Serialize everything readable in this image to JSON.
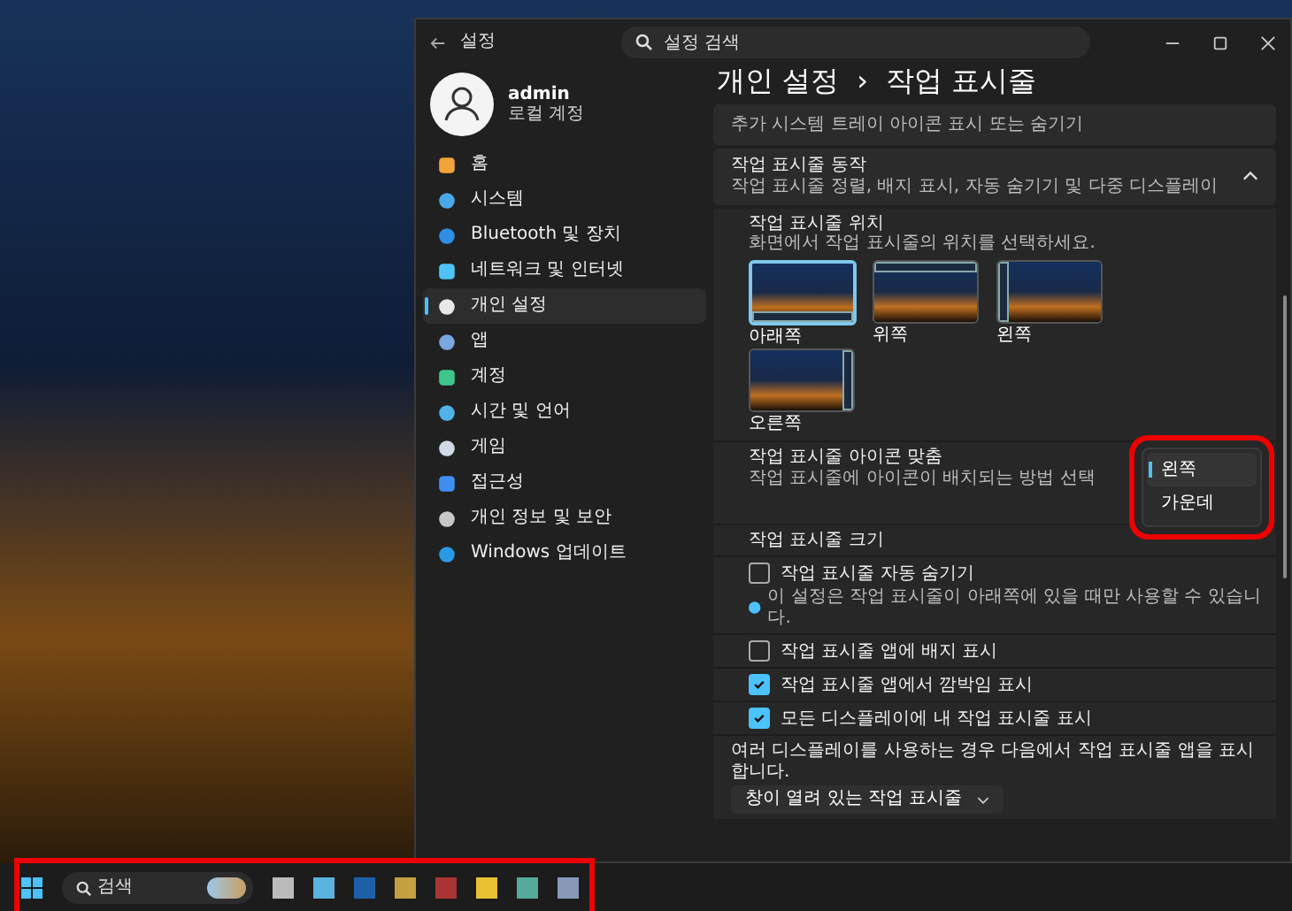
{
  "window": {
    "title": "설정",
    "search": {
      "placeholder": "설정 검색"
    }
  },
  "profile": {
    "name": "admin",
    "account": "로컬 계정"
  },
  "sidebar": {
    "items": [
      {
        "label": "홈",
        "selected": false
      },
      {
        "label": "시스템",
        "selected": false
      },
      {
        "label": "Bluetooth 및 장치",
        "selected": false
      },
      {
        "label": "네트워크 및 인터넷",
        "selected": false
      },
      {
        "label": "개인 설정",
        "selected": true
      },
      {
        "label": "앱",
        "selected": false
      },
      {
        "label": "계정",
        "selected": false
      },
      {
        "label": "시간 및 언어",
        "selected": false
      },
      {
        "label": "게임",
        "selected": false
      },
      {
        "label": "접근성",
        "selected": false
      },
      {
        "label": "개인 정보 및 보안",
        "selected": false
      },
      {
        "label": "Windows 업데이트",
        "selected": false
      }
    ]
  },
  "breadcrumb": {
    "parent": "개인 설정",
    "separator": "›",
    "current": "작업 표시줄"
  },
  "top_card": {
    "text": "추가 시스템 트레이 아이콘 표시 또는 숨기기"
  },
  "behaviors": {
    "title": "작업 표시줄 동작",
    "subtitle": "작업 표시줄 정렬, 배지 표시, 자동 숨기기 및 다중 디스플레이",
    "expanded": true,
    "position": {
      "title": "작업 표시줄 위치",
      "subtitle": "화면에서 작업 표시줄의 위치를 선택하세요.",
      "options": [
        {
          "label": "아래쪽",
          "kind": "bottom",
          "selected": true
        },
        {
          "label": "위쪽",
          "kind": "top",
          "selected": false
        },
        {
          "label": "왼쪽",
          "kind": "left",
          "selected": false
        },
        {
          "label": "오른쪽",
          "kind": "right",
          "selected": false
        }
      ]
    },
    "alignment": {
      "title": "작업 표시줄 아이콘 맞춤",
      "subtitle": "작업 표시줄에 아이콘이 배치되는 방법 선택",
      "options": [
        {
          "label": "왼쪽",
          "selected": true
        },
        {
          "label": "가운데",
          "selected": false
        }
      ]
    },
    "size": {
      "title": "작업 표시줄 크기"
    },
    "settings": [
      {
        "label": "작업 표시줄 자동 숨기기",
        "checked": false,
        "note": "이 설정은 작업 표시줄이 아래쪽에 있을 때만 사용할 수 있습니다."
      },
      {
        "label": "작업 표시줄 앱에 배지 표시",
        "checked": false
      },
      {
        "label": "작업 표시줄 앱에서 깜박임 표시",
        "checked": true
      },
      {
        "label": "모든 디스플레이에 내 작업 표시줄 표시",
        "checked": true
      }
    ],
    "multi_display": {
      "text": "여러 디스플레이를 사용하는 경우 다음에서 작업 표시줄 앱을 표시합니다.",
      "value": "창이 열려 있는 작업 표시줄"
    }
  },
  "taskbar": {
    "search": {
      "placeholder": "검색"
    }
  }
}
